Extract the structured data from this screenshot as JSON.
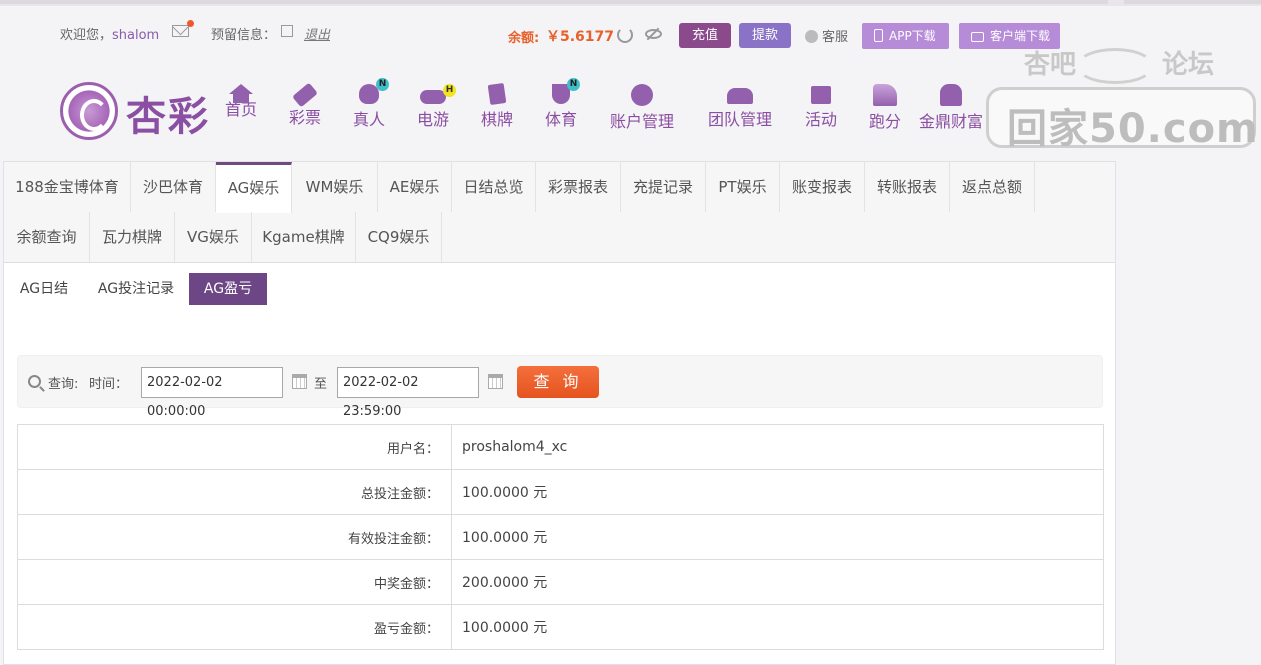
{
  "header": {
    "welcome": "欢迎您，",
    "username": "shalom",
    "reserved_info": "预留信息：",
    "logout": "退出",
    "balance_label": "余额:",
    "balance_value": "￥5.6177",
    "recharge": "充值",
    "withdraw": "提款",
    "service": "客服",
    "app_download": "APP下载",
    "client_download": "客户端下载"
  },
  "logo": {
    "text": "杏彩"
  },
  "nav": [
    {
      "label": "首页",
      "icon": "home-icon"
    },
    {
      "label": "彩票",
      "icon": "lottery-ticket-icon"
    },
    {
      "label": "真人",
      "icon": "live-dealer-icon",
      "badge": "N"
    },
    {
      "label": "电游",
      "icon": "gamepad-icon",
      "badge": "H"
    },
    {
      "label": "棋牌",
      "icon": "cards-icon"
    },
    {
      "label": "体育",
      "icon": "trophy-icon",
      "badge": "N"
    },
    {
      "label": "账户管理",
      "icon": "yen-coin-icon"
    },
    {
      "label": "团队管理",
      "icon": "team-icon"
    },
    {
      "label": "活动",
      "icon": "gift-icon"
    },
    {
      "label": "跑分",
      "icon": "racing-icon"
    },
    {
      "label": "金鼎财富",
      "icon": "treasure-icon"
    }
  ],
  "watermark": {
    "top_left": "杏吧",
    "top_right": "论坛",
    "site": "回家50.com"
  },
  "tabs_row1": [
    "188金宝博体育",
    "沙巴体育",
    "AG娱乐",
    "WM娱乐",
    "AE娱乐",
    "日结总览",
    "彩票报表",
    "充提记录",
    "PT娱乐",
    "账变报表",
    "转账报表",
    "返点总额"
  ],
  "tabs_row2": [
    "余额查询",
    "瓦力棋牌",
    "VG娱乐",
    "Kgame棋牌",
    "CQ9娱乐"
  ],
  "active_tab": "AG娱乐",
  "subtabs": [
    "AG日结",
    "AG投注记录",
    "AG盈亏"
  ],
  "active_subtab": "AG盈亏",
  "query": {
    "label": "查询:",
    "time_label": "时间：",
    "start": "2022-02-02 00:00:00",
    "to": "至",
    "end": "2022-02-02 23:59:00",
    "button": "查 询"
  },
  "result": [
    {
      "label": "用户名：",
      "value": "proshalom4_xc"
    },
    {
      "label": "总投注金额：",
      "value": "100.0000 元"
    },
    {
      "label": "有效投注金额：",
      "value": "100.0000 元"
    },
    {
      "label": "中奖金额：",
      "value": "200.0000 元"
    },
    {
      "label": "盈亏金额：",
      "value": "100.0000 元"
    }
  ],
  "colors": {
    "brand": "#8a4fa3",
    "accent": "#e8612c",
    "active_tab": "#6c4685"
  }
}
